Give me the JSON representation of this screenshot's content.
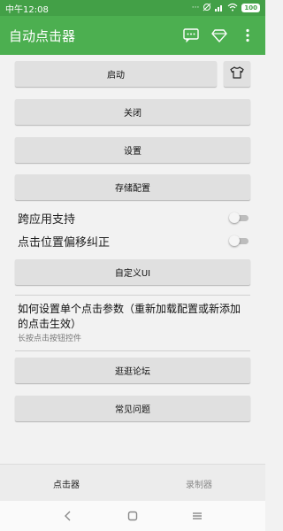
{
  "status_bar": {
    "time": "中午12:08",
    "battery": "100"
  },
  "app": {
    "title": "自动点击器"
  },
  "buttons": {
    "start": "启动",
    "close": "关闭",
    "settings": "设置",
    "save_config": "存储配置",
    "custom_ui": "自定义UI",
    "forum": "逛逛论坛",
    "faq": "常见问题"
  },
  "toggles": {
    "cross_app": {
      "label": "跨应用支持",
      "on": false
    },
    "click_offset": {
      "label": "点击位置偏移纠正",
      "on": false
    }
  },
  "help": {
    "title": "如何设置单个点击参数（重新加载配置或新添加的点击生效）",
    "subtitle": "长按点击按钮控件"
  },
  "bottom_nav": {
    "clicker": "点击器",
    "recorder": "录制器"
  },
  "colors": {
    "status_bar": "#43a047",
    "app_bar": "#4caf50"
  },
  "icons": [
    "message-icon",
    "diamond-icon",
    "more-icon",
    "shirt-icon",
    "back-icon",
    "home-icon",
    "menu-icon"
  ]
}
